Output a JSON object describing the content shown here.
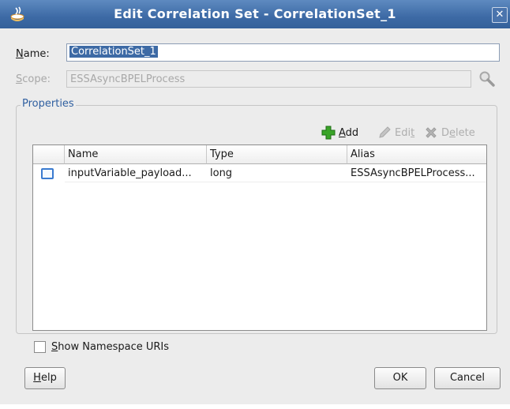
{
  "window": {
    "title": "Edit Correlation Set - CorrelationSet_1",
    "close_glyph": "✕"
  },
  "form": {
    "name_label_mnemonic": "N",
    "name_label_rest": "ame:",
    "name_value": "CorrelationSet_1",
    "scope_label_mnemonic": "S",
    "scope_label_rest": "cope:",
    "scope_value": "ESSAsyncBPELProcess"
  },
  "properties": {
    "group_title": "Properties",
    "toolbar": {
      "add_mnemonic": "A",
      "add_rest": "dd",
      "edit_pre": "Edi",
      "edit_mnemonic": "t",
      "delete_pre": "D",
      "delete_mnemonic": "e",
      "delete_rest": "lete"
    },
    "table": {
      "columns": [
        "Name",
        "Type",
        "Alias"
      ],
      "rows": [
        {
          "name": "inputVariable_payload...",
          "type": "long",
          "alias": "ESSAsyncBPELProcess..."
        }
      ]
    }
  },
  "show_namespace": {
    "mnemonic": "S",
    "rest": "how Namespace URIs",
    "checked": false
  },
  "buttons": {
    "help_mnemonic": "H",
    "help_rest": "elp",
    "ok": "OK",
    "cancel": "Cancel"
  },
  "colors": {
    "titlebar": "#3d6aa5",
    "group_title": "#2f5fa0",
    "selection": "#3d6aa5",
    "add_icon": "#3aa428"
  }
}
